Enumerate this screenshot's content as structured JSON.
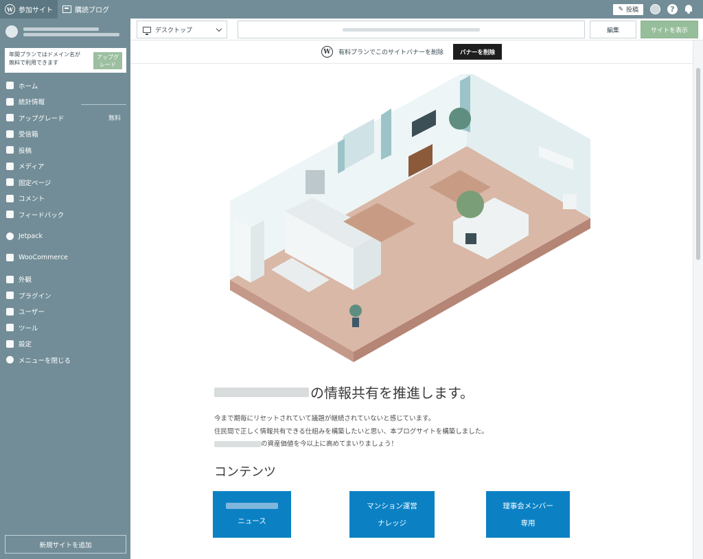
{
  "masterbar": {
    "my_sites": "参加サイト",
    "reader": "購読ブログ",
    "post": "投稿",
    "help": "?"
  },
  "sidebar": {
    "upsell_text_1": "年間プランではドメイン名が",
    "upsell_text_2": "無料で利用できます",
    "upsell_button_1": "アップグ",
    "upsell_button_2": "レード",
    "items": [
      {
        "label": "ホーム",
        "icon": "home-icon"
      },
      {
        "label": "統計情報",
        "icon": "stats-icon"
      },
      {
        "label": "アップグレード",
        "icon": "cart-icon",
        "badge": "無料"
      },
      {
        "label": "受信箱",
        "icon": "mail-icon"
      },
      {
        "label": "投稿",
        "icon": "pin-icon"
      },
      {
        "label": "メディア",
        "icon": "media-icon"
      },
      {
        "label": "固定ページ",
        "icon": "pages-icon"
      },
      {
        "label": "コメント",
        "icon": "comment-icon"
      },
      {
        "label": "フィードバック",
        "icon": "feedback-icon"
      },
      {
        "label": "Jetpack",
        "icon": "jetpack-icon"
      },
      {
        "label": "WooCommerce",
        "icon": "woo-icon"
      },
      {
        "label": "外観",
        "icon": "brush-icon"
      },
      {
        "label": "プラグイン",
        "icon": "plugin-icon"
      },
      {
        "label": "ユーザー",
        "icon": "user-icon"
      },
      {
        "label": "ツール",
        "icon": "wrench-icon"
      },
      {
        "label": "設定",
        "icon": "settings-icon"
      },
      {
        "label": "メニューを閉じる",
        "icon": "collapse-icon"
      }
    ],
    "add_site": "新規サイトを追加"
  },
  "topbar": {
    "device": "デスクトップ",
    "edit": "編集",
    "view_site": "サイトを表示"
  },
  "banner": {
    "text": "有料プランでこのサイトバナーを削除",
    "button": "バナーを削除"
  },
  "content": {
    "headline_suffix": "の情報共有を推進します。",
    "para_1": "今まで期毎にリセットされていて議題が継続されていないと感じています。",
    "para_2": "住民間で正しく情報共有できる仕組みを構築したいと思い、本ブログサイトを構築しました。",
    "para_3_suffix": "の資産価値を今以上に高めてまいりましょう！",
    "section_title": "コンテンツ",
    "buttons": [
      {
        "line2": "ニュース"
      },
      {
        "line1": "マンション運営",
        "line2": "ナレッジ"
      },
      {
        "line1": "理事会メンバー",
        "line2": "専用"
      }
    ]
  },
  "colors": {
    "sidebar": "#728d97",
    "accent_button": "#0b81c4",
    "view_site": "#97be9b"
  }
}
